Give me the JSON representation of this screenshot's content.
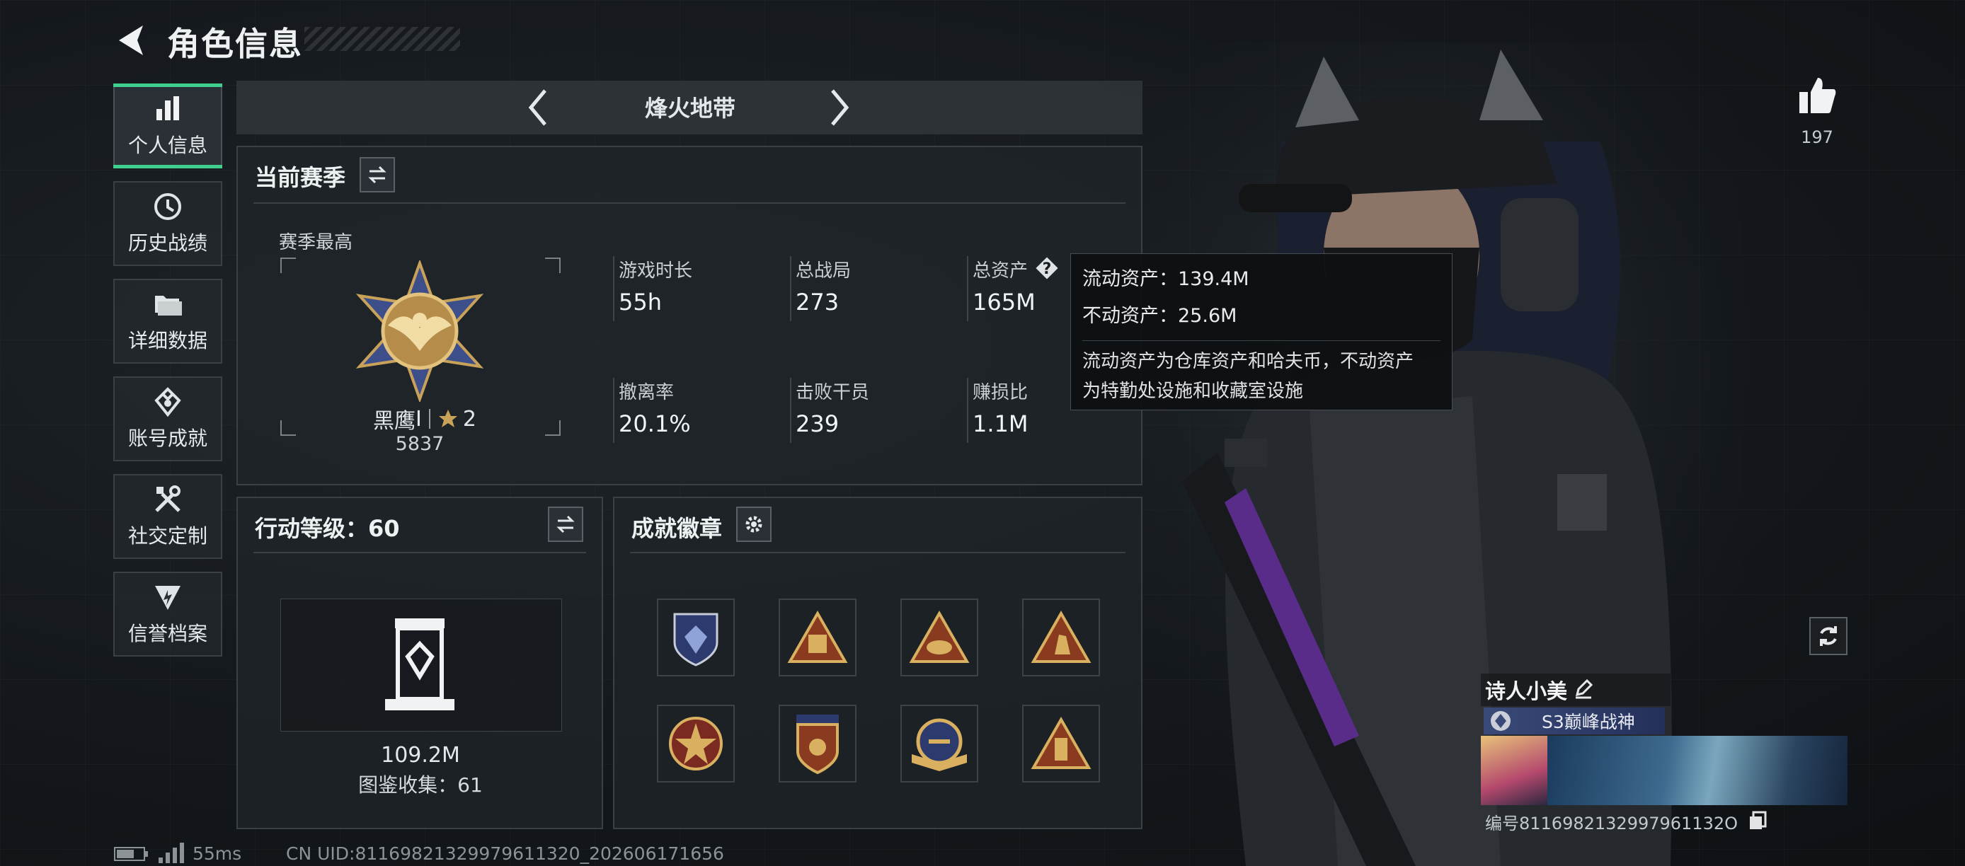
{
  "header": {
    "title": "角色信息"
  },
  "sidebar": {
    "items": [
      {
        "label": "个人信息",
        "icon": "bar-chart-icon",
        "active": true
      },
      {
        "label": "历史战绩",
        "icon": "history-clock-icon"
      },
      {
        "label": "详细数据",
        "icon": "folder-icon"
      },
      {
        "label": "账号成就",
        "icon": "achievement-icon"
      },
      {
        "label": "社交定制",
        "icon": "tools-icon"
      },
      {
        "label": "信誉档案",
        "icon": "credit-shield-icon"
      }
    ]
  },
  "mode_selector": {
    "label": "烽火地带"
  },
  "season": {
    "title": "当前赛季",
    "best_label": "赛季最高",
    "rank_name": "黑鹰",
    "rank_tier": "I",
    "rank_stars": "2",
    "rank_points": "5837",
    "stats": [
      {
        "label": "游戏时长",
        "value": "55h"
      },
      {
        "label": "总战局",
        "value": "273"
      },
      {
        "label": "总资产",
        "value": "165M"
      },
      {
        "label": "撤离率",
        "value": "20.1%"
      },
      {
        "label": "击败干员",
        "value": "239"
      },
      {
        "label": "赚损比",
        "value": "1.1M"
      }
    ]
  },
  "tooltip": {
    "liquid": "流动资产：139.4M",
    "fixed": "不动资产：25.6M",
    "desc_line1": "流动资产为仓库资产和哈夫币，不动资产",
    "desc_line2": "为特勤处设施和收藏室设施"
  },
  "action_level": {
    "title": "行动等级：60",
    "value": "109.2M",
    "collection": "图鉴收集：61"
  },
  "achievements": {
    "title": "成就徽章",
    "badges": [
      "shield-crystal-badge",
      "pyramid-eye-badge",
      "triangle-helmet-badge",
      "triangle-figure-badge",
      "star-circle-badge",
      "shield-stars-badge",
      "wings-medal-badge",
      "triangle-tower-badge"
    ]
  },
  "profile": {
    "likes": "197",
    "player_name": "诗人小美",
    "title_badge": "S3巅峰战神",
    "id_text": "编号8116982132997961132O"
  },
  "status_bar": {
    "ping": "55ms",
    "uid": "CN UID:81169821329979611320_202606171656"
  },
  "colors": {
    "accent": "#3fcf8e",
    "panel_border": "#3a4045",
    "gold": "#c9a25a"
  }
}
